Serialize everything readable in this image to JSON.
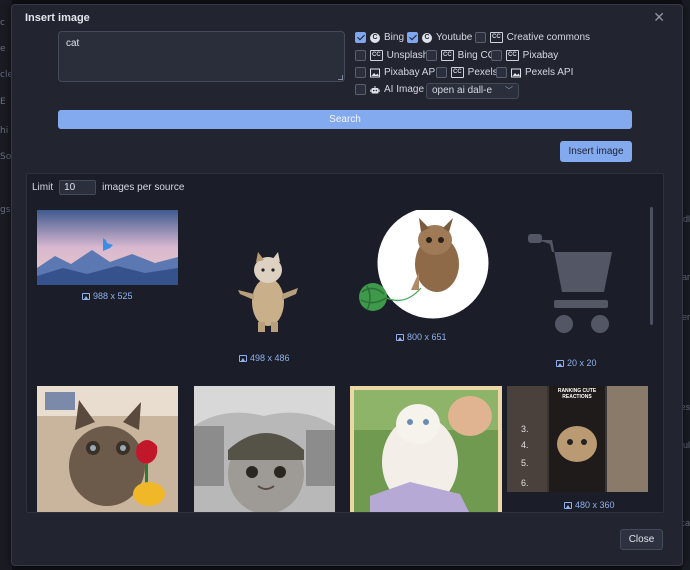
{
  "background": {
    "left_fragments": [
      "c",
      "e",
      "cle",
      "E",
      "hi",
      "So",
      "gs"
    ],
    "right_fragments": [
      "",
      "dl",
      "ar",
      "er",
      "les",
      "ul",
      "ca"
    ]
  },
  "dialog": {
    "title": "Insert image",
    "close_glyph": "✕",
    "query": "cat",
    "sources": [
      {
        "label": "Bing",
        "checked": true,
        "icon": "c-logo-icon"
      },
      {
        "label": "Youtube",
        "checked": true,
        "icon": "c-logo-icon"
      },
      {
        "label": "Creative commons",
        "checked": false,
        "icon": "cc-icon"
      },
      {
        "label": "Unsplash",
        "checked": false,
        "icon": "cc-icon"
      },
      {
        "label": "Bing CC",
        "checked": false,
        "icon": "cc-icon"
      },
      {
        "label": "Pixabay",
        "checked": false,
        "icon": "cc-icon"
      },
      {
        "label": "Pixabay API",
        "checked": false,
        "icon": "image-icon"
      },
      {
        "label": "Pexels",
        "checked": false,
        "icon": "cc-icon"
      },
      {
        "label": "Pexels API",
        "checked": false,
        "icon": "image-icon"
      },
      {
        "label": "AI Image",
        "checked": false,
        "icon": "robot-icon"
      }
    ],
    "ai_model": "open ai dall-e",
    "search_label": "Search",
    "insert_label": "Insert image",
    "limit_label": "Limit",
    "limit_value": "10",
    "per_source_label": "images per source",
    "close_label": "Close",
    "results": [
      {
        "caption": "988 x 525"
      },
      {
        "caption": "498 x 486"
      },
      {
        "caption": "800 x 651"
      },
      {
        "caption": "20 x 20"
      },
      {
        "caption": ""
      },
      {
        "caption": ""
      },
      {
        "caption": ""
      },
      {
        "caption": "480 x 360"
      }
    ],
    "overlay_text": "RANKING CUTE REACTIONS"
  },
  "colors": {
    "accent": "#83a9ef",
    "dialog_bg": "#22252f",
    "panel_bg": "#1b1e28",
    "caption": "#8fb0ec"
  }
}
